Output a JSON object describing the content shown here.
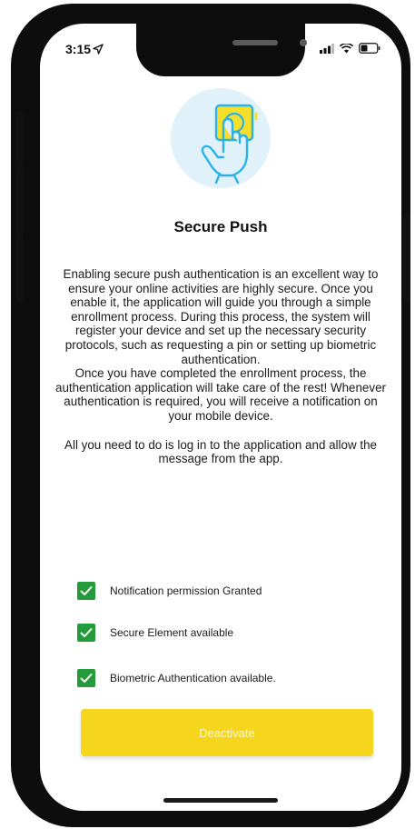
{
  "status_bar": {
    "time": "3:15"
  },
  "screen": {
    "title": "Secure Push",
    "description_paragraphs": [
      "Enabling secure push authentication is an excellent way to ensure your online activities are highly secure. Once you enable it, the application will guide you through a simple enrollment process. During this process, the system will register your device and set up the necessary security protocols, such as requesting a pin or setting up biometric authentication.",
      "Once you have completed the enrollment process, the authentication application will take care of the rest! Whenever authentication is required, you will receive a notification on your mobile device.",
      "All you need to do is log in to the application and allow the message from the app."
    ],
    "checks": [
      {
        "label": "Notification permission Granted",
        "checked": true
      },
      {
        "label": "Secure Element available",
        "checked": true
      },
      {
        "label": "Biometric Authentication available.",
        "checked": true
      }
    ],
    "deactivate_label": "Deactivate"
  },
  "colors": {
    "accent_yellow": "#f5d61c",
    "check_green": "#239b3a",
    "icon_blue": "#2ab3e6",
    "hero_bg": "#e1f1fa"
  },
  "icons": {
    "location": "location-arrow-icon",
    "signal": "signal-icon",
    "wifi": "wifi-icon",
    "battery": "battery-icon",
    "hero": "touch-hand-icon",
    "check": "checkmark-icon"
  }
}
